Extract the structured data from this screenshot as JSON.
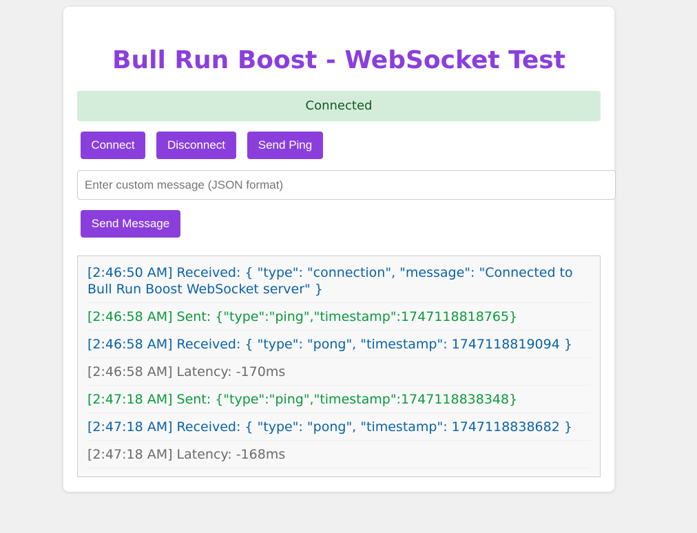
{
  "page": {
    "title": "Bull Run Boost - WebSocket Test"
  },
  "status": {
    "text": "Connected"
  },
  "buttons": {
    "connect": "Connect",
    "disconnect": "Disconnect",
    "ping": "Send Ping",
    "send": "Send Message"
  },
  "input": {
    "placeholder": "Enter custom message (JSON format)",
    "value": ""
  },
  "log": [
    {
      "kind": "received",
      "text": "[2:46:50 AM] Received: { \"type\": \"connection\", \"message\": \"Connected to Bull Run Boost WebSocket server\" }"
    },
    {
      "kind": "sent",
      "text": "[2:46:58 AM] Sent: {\"type\":\"ping\",\"timestamp\":1747118818765}"
    },
    {
      "kind": "received",
      "text": "[2:46:58 AM] Received: { \"type\": \"pong\", \"timestamp\": 1747118819094 }"
    },
    {
      "kind": "info",
      "text": "[2:46:58 AM] Latency: -170ms"
    },
    {
      "kind": "sent",
      "text": "[2:47:18 AM] Sent: {\"type\":\"ping\",\"timestamp\":1747118838348}"
    },
    {
      "kind": "received",
      "text": "[2:47:18 AM] Received: { \"type\": \"pong\", \"timestamp\": 1747118838682 }"
    },
    {
      "kind": "info",
      "text": "[2:47:18 AM] Latency: -168ms"
    }
  ],
  "colors": {
    "accent": "#8a3fdd",
    "status_bg": "#d4edda",
    "status_text": "#155724",
    "received": "#0a62a8",
    "sent": "#0a9a3c",
    "info": "#6b6b6b"
  }
}
